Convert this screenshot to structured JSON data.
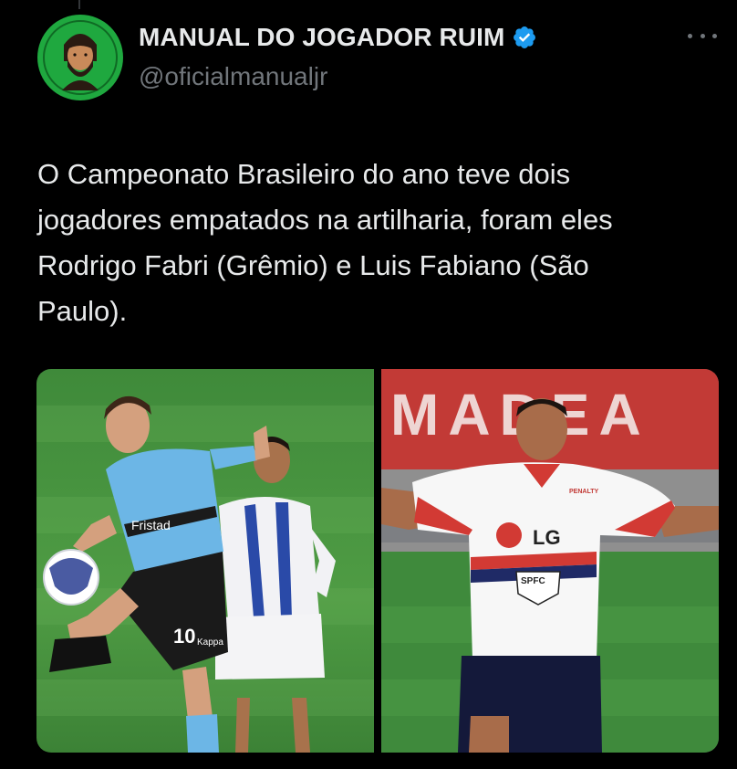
{
  "author": {
    "display_name": "MANUAL DO JOGADOR RUIM",
    "handle": "@oficialmanualjr",
    "verified": true,
    "avatar_icon": "bearded-player-avatar",
    "verified_icon": "verified-badge-icon"
  },
  "actions": {
    "more_icon": "more-options-icon"
  },
  "tweet": {
    "text": "O Campeonato Brasileiro do ano teve dois\njogadores empatados na artilharia, foram eles\nRodrigo Fabri (Grêmio) e Luis Fabiano (São\nPaulo)."
  },
  "media": {
    "left_photo": {
      "shirt_sponsor": "Fristad",
      "shirt_number": "10",
      "shorts_brand": "Kappa"
    },
    "right_photo": {
      "stadium_banner": "MADEA",
      "shirt_sponsor": "LG",
      "crest_text": "SPFC",
      "kit_brand": "PENALTY"
    }
  },
  "colors": {
    "background": "#000000",
    "text_primary": "#e7e9ea",
    "text_secondary": "#71767b",
    "verified_blue": "#1d9bf0",
    "avatar_green": "#1fa83f"
  }
}
